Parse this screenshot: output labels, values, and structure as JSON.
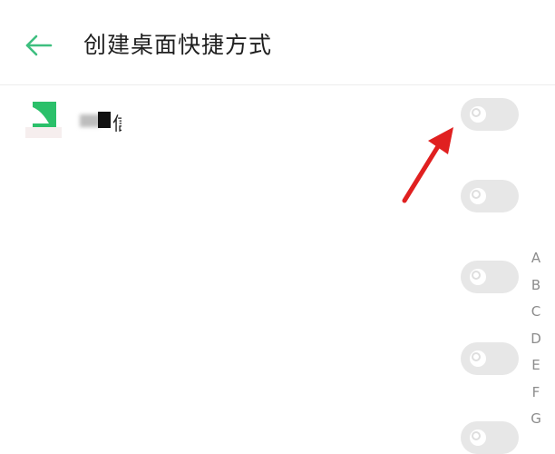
{
  "header": {
    "title": "创建桌面快捷方式",
    "back_icon": "arrow-left-icon",
    "accent": "#3ebf7f"
  },
  "apps": [
    {
      "name": "信",
      "icon": "app-logo-icon",
      "enabled": false
    },
    {
      "name": "",
      "icon": "",
      "enabled": false
    },
    {
      "name": "",
      "icon": "",
      "enabled": false
    },
    {
      "name": "",
      "icon": "",
      "enabled": false
    },
    {
      "name": "",
      "icon": "",
      "enabled": false
    }
  ],
  "index_letters": [
    "A",
    "B",
    "C",
    "D",
    "E",
    "F",
    "G"
  ],
  "annotation": {
    "icon": "red-arrow-icon",
    "color": "#e02020"
  },
  "colors": {
    "toggle_off": "#e7e7e7",
    "index_text": "#8c8c8c"
  }
}
